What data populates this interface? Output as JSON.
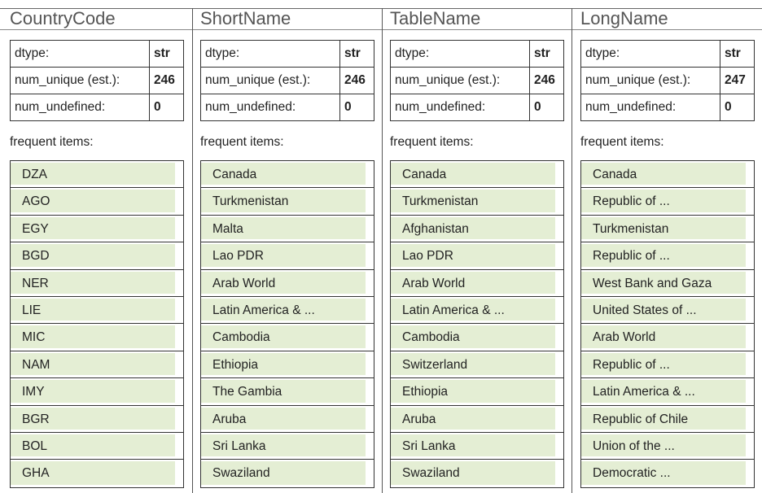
{
  "columns": [
    {
      "name": "CountryCode",
      "stats": [
        {
          "label": "dtype:",
          "value": "str"
        },
        {
          "label": "num_unique (est.):",
          "value": "246"
        },
        {
          "label": "num_undefined:",
          "value": "0"
        }
      ],
      "frequent_label": "frequent items:",
      "items": [
        "DZA",
        "AGO",
        "EGY",
        "BGD",
        "NER",
        "LIE",
        "MIC",
        "NAM",
        "IMY",
        "BGR",
        "BOL",
        "GHA"
      ]
    },
    {
      "name": "ShortName",
      "stats": [
        {
          "label": "dtype:",
          "value": "str"
        },
        {
          "label": "num_unique (est.):",
          "value": "246"
        },
        {
          "label": "num_undefined:",
          "value": "0"
        }
      ],
      "frequent_label": "frequent items:",
      "items": [
        "Canada",
        "Turkmenistan",
        "Malta",
        "Lao PDR",
        "Arab World",
        "Latin America & ...",
        "Cambodia",
        "Ethiopia",
        "The Gambia",
        "Aruba",
        "Sri Lanka",
        "Swaziland"
      ]
    },
    {
      "name": "TableName",
      "stats": [
        {
          "label": "dtype:",
          "value": "str"
        },
        {
          "label": "num_unique (est.):",
          "value": "246"
        },
        {
          "label": "num_undefined:",
          "value": "0"
        }
      ],
      "frequent_label": "frequent items:",
      "items": [
        "Canada",
        "Turkmenistan",
        "Afghanistan",
        "Lao PDR",
        "Arab World",
        "Latin America & ...",
        "Cambodia",
        "Switzerland",
        "Ethiopia",
        "Aruba",
        "Sri Lanka",
        "Swaziland"
      ]
    },
    {
      "name": "LongName",
      "stats": [
        {
          "label": "dtype:",
          "value": "str"
        },
        {
          "label": "num_unique (est.):",
          "value": "247"
        },
        {
          "label": "num_undefined:",
          "value": "0"
        }
      ],
      "frequent_label": "frequent items:",
      "items": [
        "Canada",
        "Republic of ...",
        "Turkmenistan",
        "Republic of ...",
        "West Bank and Gaza",
        "United States of ...",
        "Arab World",
        "Republic of ...",
        "Latin America & ...",
        "Republic of Chile",
        "Union of the ...",
        "Democratic ..."
      ]
    }
  ]
}
